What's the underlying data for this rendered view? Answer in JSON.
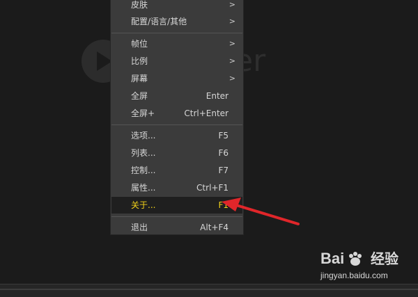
{
  "player": {
    "logo_text": "er"
  },
  "menu": {
    "items": [
      {
        "label": "皮肤",
        "shortcut": "",
        "submenu": true
      },
      {
        "label": "配置/语言/其他",
        "shortcut": "",
        "submenu": true
      },
      {
        "label": "帧位",
        "shortcut": "",
        "submenu": true
      },
      {
        "label": "比例",
        "shortcut": "",
        "submenu": true
      },
      {
        "label": "屏幕",
        "shortcut": "",
        "submenu": true
      },
      {
        "label": "全屏",
        "shortcut": "Enter",
        "submenu": false
      },
      {
        "label": "全屏+",
        "shortcut": "Ctrl+Enter",
        "submenu": false
      },
      {
        "label": "选项...",
        "shortcut": "F5",
        "submenu": false
      },
      {
        "label": "列表...",
        "shortcut": "F6",
        "submenu": false
      },
      {
        "label": "控制...",
        "shortcut": "F7",
        "submenu": false
      },
      {
        "label": "属性...",
        "shortcut": "Ctrl+F1",
        "submenu": false
      },
      {
        "label": "关于...",
        "shortcut": "F1",
        "submenu": false,
        "highlighted": true
      },
      {
        "label": "退出",
        "shortcut": "Alt+F4",
        "submenu": false
      }
    ],
    "submenu_glyph": ">"
  },
  "watermark": {
    "brand_left": "Bai",
    "brand_right": "经验",
    "url": "jingyan.baidu.com"
  },
  "colors": {
    "highlight_text": "#f2d21a",
    "annotation_arrow": "#e0262a"
  }
}
